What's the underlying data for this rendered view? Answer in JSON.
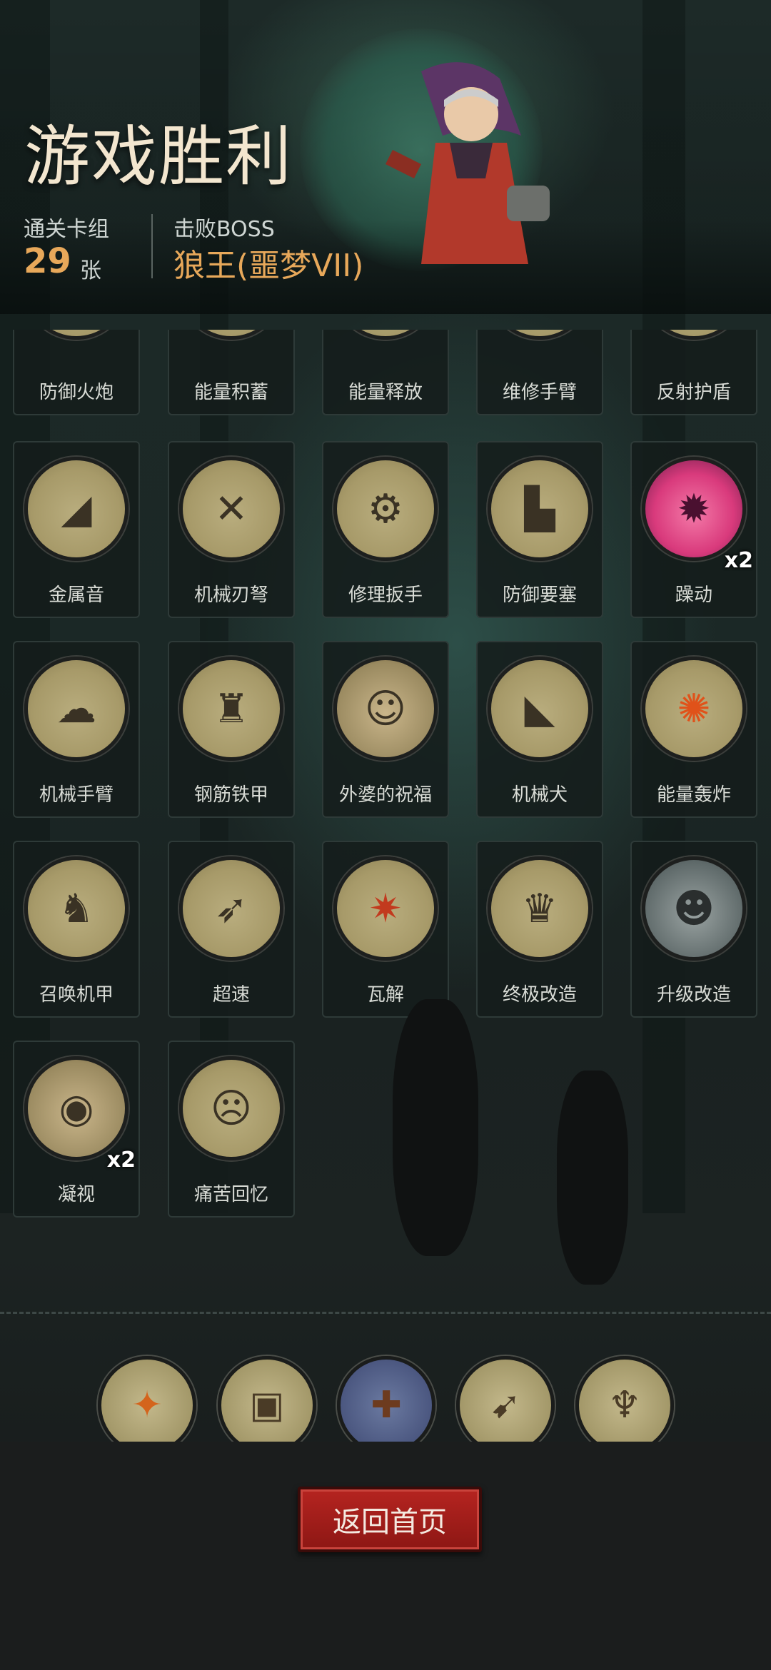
{
  "header": {
    "title": "游戏胜利",
    "clear_deck_label": "通关卡组",
    "clear_deck_count": "29",
    "clear_deck_unit": "张",
    "boss_label": "击败BOSS",
    "boss_name": "狼王(噩梦VII)"
  },
  "cards": [
    {
      "name": "防御火炮",
      "icon": "cannon-icon"
    },
    {
      "name": "能量积蓄",
      "icon": "energy-store-icon"
    },
    {
      "name": "能量释放",
      "icon": "energy-release-icon"
    },
    {
      "name": "维修手臂",
      "icon": "repair-arm-icon"
    },
    {
      "name": "反射护盾",
      "icon": "reflect-shield-icon"
    },
    {
      "name": "金属音",
      "icon": "metal-sound-icon"
    },
    {
      "name": "机械刃弩",
      "icon": "blade-crossbow-icon"
    },
    {
      "name": "修理扳手",
      "icon": "wrench-icon"
    },
    {
      "name": "防御要塞",
      "icon": "fortress-icon"
    },
    {
      "name": "躁动",
      "icon": "restless-icon",
      "count": "x2"
    },
    {
      "name": "机械手臂",
      "icon": "mech-arm-icon"
    },
    {
      "name": "钢筋铁甲",
      "icon": "steel-armor-icon"
    },
    {
      "name": "外婆的祝福",
      "icon": "grandma-blessing-icon"
    },
    {
      "name": "机械犬",
      "icon": "mech-dog-icon"
    },
    {
      "name": "能量轰炸",
      "icon": "energy-bomb-icon"
    },
    {
      "name": "召唤机甲",
      "icon": "summon-mech-icon"
    },
    {
      "name": "超速",
      "icon": "overspeed-icon"
    },
    {
      "name": "瓦解",
      "icon": "disintegrate-icon"
    },
    {
      "name": "终极改造",
      "icon": "ultimate-mod-icon"
    },
    {
      "name": "升级改造",
      "icon": "upgrade-mod-icon"
    },
    {
      "name": "凝视",
      "icon": "gaze-owl-icon",
      "count": "x2"
    },
    {
      "name": "痛苦回忆",
      "icon": "painful-memory-icon"
    }
  ],
  "relics": [
    {
      "icon": "fire-drill-relic-icon"
    },
    {
      "icon": "machine-relic-icon"
    },
    {
      "icon": "holy-book-relic-icon"
    },
    {
      "icon": "arrows-relic-icon"
    },
    {
      "icon": "gargoyle-relic-icon"
    }
  ],
  "footer": {
    "return_button": "返回首页"
  },
  "colors": {
    "accent_gold": "#e8a85a",
    "button_red": "#b52420",
    "card_bg": "#141c1b"
  }
}
